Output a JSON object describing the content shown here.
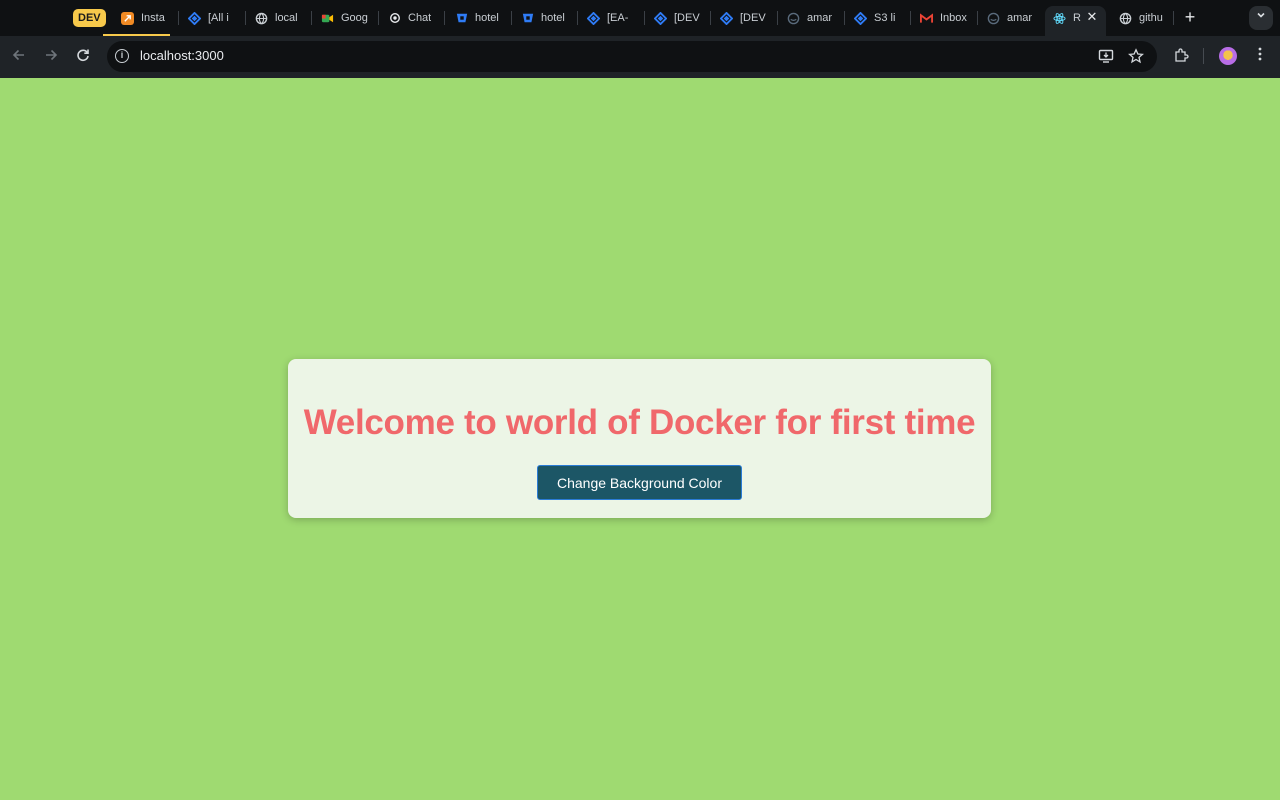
{
  "browser": {
    "group_chip": "DEV",
    "tabs": [
      {
        "title": "Insta",
        "icon": "app-orange-icon",
        "color": "#f08a24"
      },
      {
        "title": "[All i",
        "icon": "jira-icon",
        "color": "#2f7cf6"
      },
      {
        "title": "local",
        "icon": "globe-icon",
        "color": "#c9ced3"
      },
      {
        "title": "Goog",
        "icon": "google-meet-icon",
        "color": "#34a853"
      },
      {
        "title": "Chat",
        "icon": "chatgpt-icon",
        "color": "#e8eaed"
      },
      {
        "title": "hotel",
        "icon": "bitbucket-icon",
        "color": "#2f7cf6"
      },
      {
        "title": "hotel",
        "icon": "bitbucket-icon",
        "color": "#2f7cf6"
      },
      {
        "title": "[EA-",
        "icon": "jira-icon",
        "color": "#2f7cf6"
      },
      {
        "title": "[DEV",
        "icon": "jira-icon",
        "color": "#2f7cf6"
      },
      {
        "title": "[DEV",
        "icon": "jira-icon",
        "color": "#2f7cf6"
      },
      {
        "title": "amar",
        "icon": "aws-icon",
        "color": "#5a6b7c"
      },
      {
        "title": "S3 li",
        "icon": "jira-icon",
        "color": "#2f7cf6"
      },
      {
        "title": "Inbox",
        "icon": "gmail-icon",
        "color": "#ea4335"
      },
      {
        "title": "amar",
        "icon": "aws-icon",
        "color": "#5a6b7c"
      },
      {
        "title": "R",
        "icon": "react-icon",
        "color": "#61dafb"
      },
      {
        "title": "githu",
        "icon": "globe-icon",
        "color": "#c9ced3"
      }
    ],
    "url": "localhost:3000"
  },
  "page": {
    "heading": "Welcome to world of Docker for first time",
    "button_label": "Change Background Color",
    "colors": {
      "background": "#9fda71",
      "card": "#ecf5e6",
      "heading": "#f0686b",
      "button": "#1c5666"
    }
  }
}
